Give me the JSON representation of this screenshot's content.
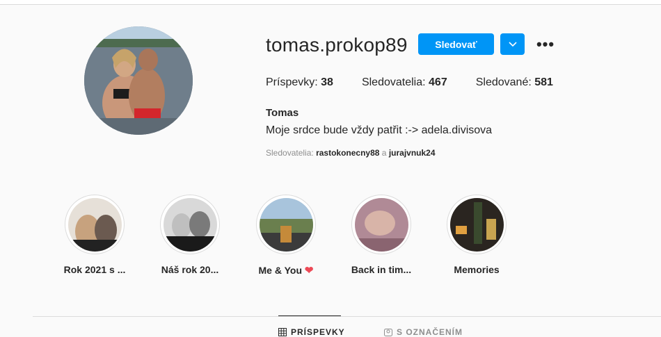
{
  "profile": {
    "username": "tomas.prokop89",
    "follow_label": "Sledovať",
    "more_label": "•••",
    "stats": [
      {
        "label": "Príspevky:",
        "value": "38"
      },
      {
        "label": "Sledovatelia:",
        "value": "467"
      },
      {
        "label": "Sledované:",
        "value": "581"
      }
    ],
    "name": "Tomas",
    "bio": "Moje srdce bude vždy patřit :-> adela.divisova",
    "followed_by_label": "Sledovatelia:",
    "followed_by_users": [
      "rastokonecny88",
      "jurajvnuk24"
    ],
    "followed_by_conj": "a"
  },
  "highlights": [
    {
      "label": "Rok 2021 s ..."
    },
    {
      "label": "Náš rok 20..."
    },
    {
      "label": "Me & You",
      "emoji": "❤"
    },
    {
      "label": "Back in tim..."
    },
    {
      "label": "Memories"
    }
  ],
  "tabs": [
    {
      "label": "PRÍSPEVKY",
      "icon": "grid-icon"
    },
    {
      "label": "S OZNAČENÍM",
      "icon": "tag-icon"
    }
  ],
  "colors": {
    "accent": "#0095f6",
    "heart": "#ed4956"
  }
}
